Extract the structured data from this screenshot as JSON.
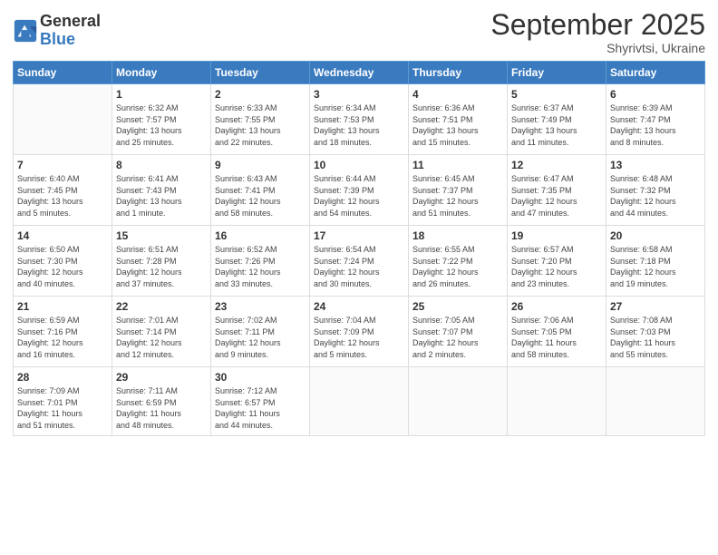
{
  "header": {
    "logo_general": "General",
    "logo_blue": "Blue",
    "month_title": "September 2025",
    "subtitle": "Shyrivtsi, Ukraine"
  },
  "days_of_week": [
    "Sunday",
    "Monday",
    "Tuesday",
    "Wednesday",
    "Thursday",
    "Friday",
    "Saturday"
  ],
  "weeks": [
    [
      {
        "day": "",
        "info": ""
      },
      {
        "day": "1",
        "info": "Sunrise: 6:32 AM\nSunset: 7:57 PM\nDaylight: 13 hours\nand 25 minutes."
      },
      {
        "day": "2",
        "info": "Sunrise: 6:33 AM\nSunset: 7:55 PM\nDaylight: 13 hours\nand 22 minutes."
      },
      {
        "day": "3",
        "info": "Sunrise: 6:34 AM\nSunset: 7:53 PM\nDaylight: 13 hours\nand 18 minutes."
      },
      {
        "day": "4",
        "info": "Sunrise: 6:36 AM\nSunset: 7:51 PM\nDaylight: 13 hours\nand 15 minutes."
      },
      {
        "day": "5",
        "info": "Sunrise: 6:37 AM\nSunset: 7:49 PM\nDaylight: 13 hours\nand 11 minutes."
      },
      {
        "day": "6",
        "info": "Sunrise: 6:39 AM\nSunset: 7:47 PM\nDaylight: 13 hours\nand 8 minutes."
      }
    ],
    [
      {
        "day": "7",
        "info": "Sunrise: 6:40 AM\nSunset: 7:45 PM\nDaylight: 13 hours\nand 5 minutes."
      },
      {
        "day": "8",
        "info": "Sunrise: 6:41 AM\nSunset: 7:43 PM\nDaylight: 13 hours\nand 1 minute."
      },
      {
        "day": "9",
        "info": "Sunrise: 6:43 AM\nSunset: 7:41 PM\nDaylight: 12 hours\nand 58 minutes."
      },
      {
        "day": "10",
        "info": "Sunrise: 6:44 AM\nSunset: 7:39 PM\nDaylight: 12 hours\nand 54 minutes."
      },
      {
        "day": "11",
        "info": "Sunrise: 6:45 AM\nSunset: 7:37 PM\nDaylight: 12 hours\nand 51 minutes."
      },
      {
        "day": "12",
        "info": "Sunrise: 6:47 AM\nSunset: 7:35 PM\nDaylight: 12 hours\nand 47 minutes."
      },
      {
        "day": "13",
        "info": "Sunrise: 6:48 AM\nSunset: 7:32 PM\nDaylight: 12 hours\nand 44 minutes."
      }
    ],
    [
      {
        "day": "14",
        "info": "Sunrise: 6:50 AM\nSunset: 7:30 PM\nDaylight: 12 hours\nand 40 minutes."
      },
      {
        "day": "15",
        "info": "Sunrise: 6:51 AM\nSunset: 7:28 PM\nDaylight: 12 hours\nand 37 minutes."
      },
      {
        "day": "16",
        "info": "Sunrise: 6:52 AM\nSunset: 7:26 PM\nDaylight: 12 hours\nand 33 minutes."
      },
      {
        "day": "17",
        "info": "Sunrise: 6:54 AM\nSunset: 7:24 PM\nDaylight: 12 hours\nand 30 minutes."
      },
      {
        "day": "18",
        "info": "Sunrise: 6:55 AM\nSunset: 7:22 PM\nDaylight: 12 hours\nand 26 minutes."
      },
      {
        "day": "19",
        "info": "Sunrise: 6:57 AM\nSunset: 7:20 PM\nDaylight: 12 hours\nand 23 minutes."
      },
      {
        "day": "20",
        "info": "Sunrise: 6:58 AM\nSunset: 7:18 PM\nDaylight: 12 hours\nand 19 minutes."
      }
    ],
    [
      {
        "day": "21",
        "info": "Sunrise: 6:59 AM\nSunset: 7:16 PM\nDaylight: 12 hours\nand 16 minutes."
      },
      {
        "day": "22",
        "info": "Sunrise: 7:01 AM\nSunset: 7:14 PM\nDaylight: 12 hours\nand 12 minutes."
      },
      {
        "day": "23",
        "info": "Sunrise: 7:02 AM\nSunset: 7:11 PM\nDaylight: 12 hours\nand 9 minutes."
      },
      {
        "day": "24",
        "info": "Sunrise: 7:04 AM\nSunset: 7:09 PM\nDaylight: 12 hours\nand 5 minutes."
      },
      {
        "day": "25",
        "info": "Sunrise: 7:05 AM\nSunset: 7:07 PM\nDaylight: 12 hours\nand 2 minutes."
      },
      {
        "day": "26",
        "info": "Sunrise: 7:06 AM\nSunset: 7:05 PM\nDaylight: 11 hours\nand 58 minutes."
      },
      {
        "day": "27",
        "info": "Sunrise: 7:08 AM\nSunset: 7:03 PM\nDaylight: 11 hours\nand 55 minutes."
      }
    ],
    [
      {
        "day": "28",
        "info": "Sunrise: 7:09 AM\nSunset: 7:01 PM\nDaylight: 11 hours\nand 51 minutes."
      },
      {
        "day": "29",
        "info": "Sunrise: 7:11 AM\nSunset: 6:59 PM\nDaylight: 11 hours\nand 48 minutes."
      },
      {
        "day": "30",
        "info": "Sunrise: 7:12 AM\nSunset: 6:57 PM\nDaylight: 11 hours\nand 44 minutes."
      },
      {
        "day": "",
        "info": ""
      },
      {
        "day": "",
        "info": ""
      },
      {
        "day": "",
        "info": ""
      },
      {
        "day": "",
        "info": ""
      }
    ]
  ]
}
